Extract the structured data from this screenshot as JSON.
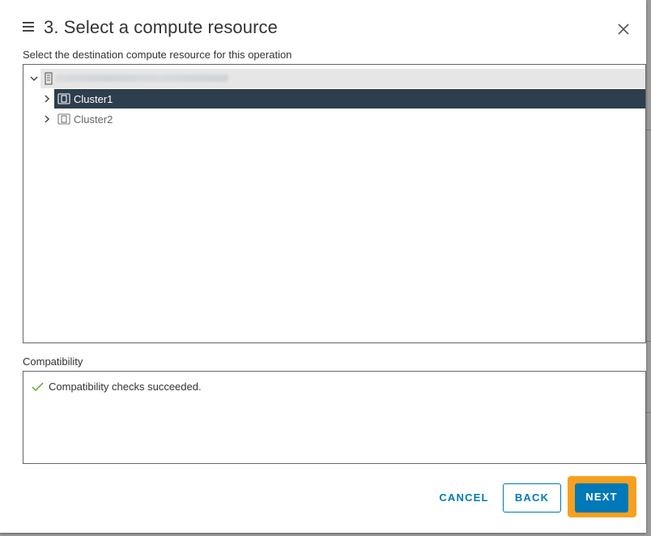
{
  "dialog": {
    "title": "3. Select a compute resource",
    "subtitle": "Select the destination compute resource for this operation"
  },
  "tree": {
    "root": {
      "label": "",
      "icon": "datacenter-icon",
      "expanded": true
    },
    "items": [
      {
        "label": "Cluster1",
        "icon": "cluster-icon",
        "selected": true,
        "expanded": false
      },
      {
        "label": "Cluster2",
        "icon": "cluster-icon",
        "selected": false,
        "expanded": false
      }
    ]
  },
  "compatibility": {
    "label": "Compatibility",
    "message": "Compatibility checks succeeded.",
    "status_icon": "check-icon"
  },
  "footer": {
    "cancel_label": "CANCEL",
    "back_label": "BACK",
    "next_label": "NEXT"
  },
  "colors": {
    "primary": "#0079b8",
    "selected_row": "#2d3e4c",
    "highlight": "#f7a01f",
    "success": "#5aa220"
  }
}
